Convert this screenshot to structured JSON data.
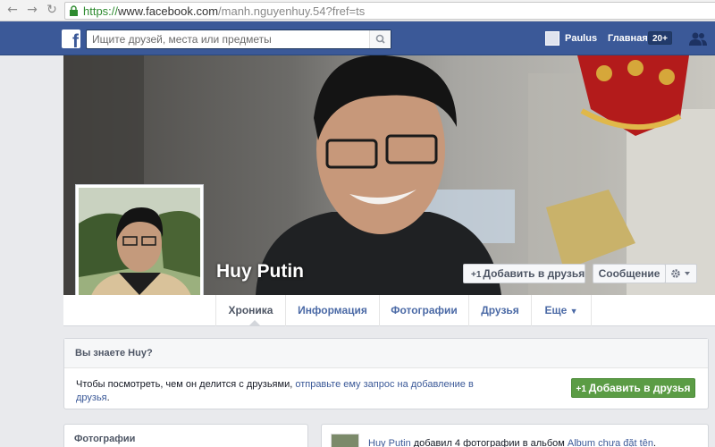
{
  "browser": {
    "url_scheme": "https://",
    "url_host": "www.facebook.com",
    "url_path": "/manh.nguyenhuy.54?fref=ts"
  },
  "topbar": {
    "logo": "f",
    "search_placeholder": "Ищите друзей, места или предметы",
    "username": "Paulus",
    "home_label": "Главная",
    "home_badge": "20+"
  },
  "profile": {
    "name": "Huy Putin",
    "add_friend_label": "Добавить в друзья",
    "message_label": "Сообщение"
  },
  "tabs": [
    {
      "label": "Хроника",
      "active": true
    },
    {
      "label": "Информация",
      "active": false
    },
    {
      "label": "Фотографии",
      "active": false
    },
    {
      "label": "Друзья",
      "active": false
    },
    {
      "label": "Еще",
      "active": false
    }
  ],
  "know_box": {
    "title": "Вы знаете Huy?",
    "text_prefix": "Чтобы посмотреть, чем он делится с друзьями, ",
    "link_text": "отправьте ему запрос на добавление в друзья",
    "text_suffix": ".",
    "button_label": "Добавить в друзья"
  },
  "photos_card": {
    "title": "Фотографии"
  },
  "post": {
    "author": "Huy Putin",
    "text_middle": " добавил 4 фотографии в альбом ",
    "album_name": "Album chưa đặt tên",
    "text_end": "."
  },
  "colors": {
    "fb_blue": "#3b5998",
    "green_button": "#5b9c45",
    "link": "#3b5998"
  }
}
